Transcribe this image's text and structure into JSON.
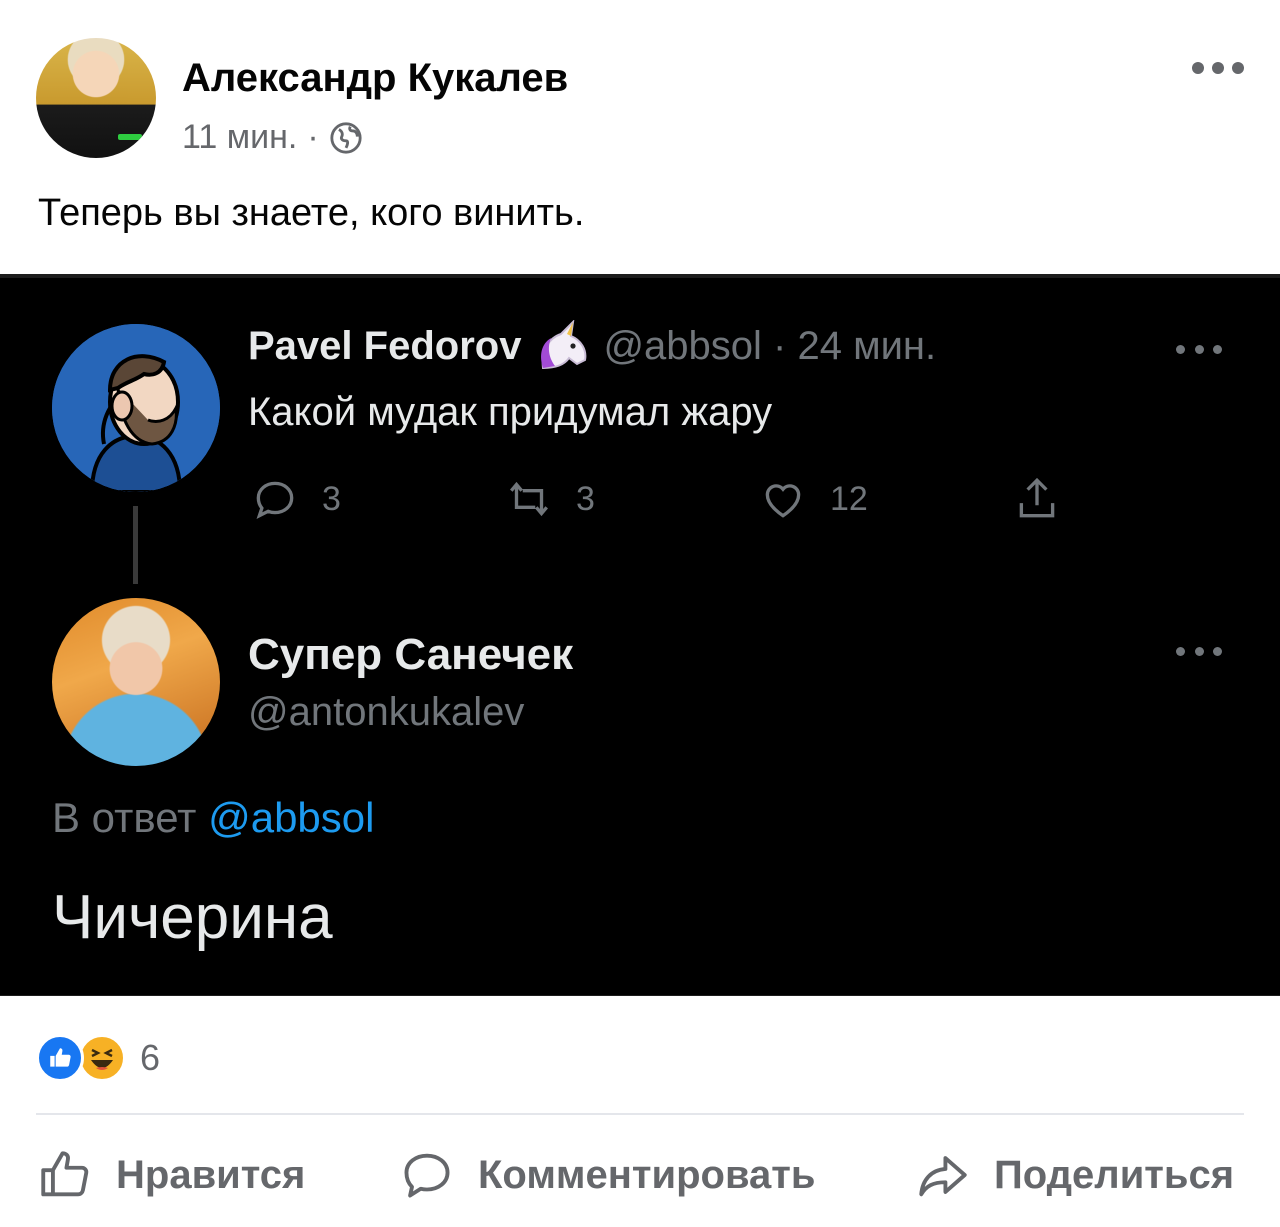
{
  "post": {
    "author": "Александр Кукалев",
    "time": "11 мин.",
    "separator": "·",
    "text": "Теперь вы знаете, кого винить."
  },
  "tweet_reply_target": {
    "name": "Pavel Fedorov",
    "handle_time": "@abbsol · 24 мин.",
    "text": "Какой мудак придумал жару",
    "replies": "3",
    "retweets": "3",
    "likes": "12"
  },
  "tweet_reply": {
    "name": "Супер Санечек",
    "handle": "@antonkukalev",
    "reply_prefix": "В ответ",
    "reply_handle": "@abbsol",
    "text": "Чичерина"
  },
  "reactions": {
    "count": "6",
    "icons": [
      "like-icon",
      "haha-icon"
    ]
  },
  "actions": {
    "like": "Нравится",
    "comment": "Комментировать",
    "share": "Поделиться"
  },
  "colors": {
    "facebook_blue": "#1877f2",
    "twitter_link": "#1d9bf0",
    "muted": "#65676b"
  }
}
